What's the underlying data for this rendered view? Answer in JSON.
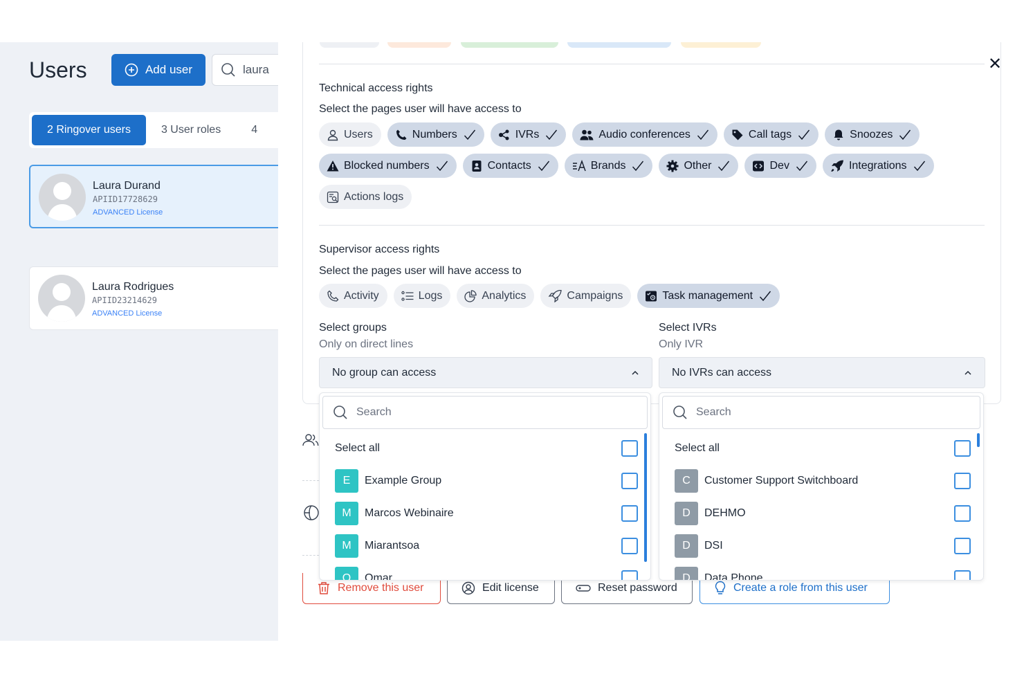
{
  "header": {
    "title": "Users",
    "add_user_label": "Add user",
    "search_value": "laura"
  },
  "tabs": [
    {
      "label": "2 Ringover users",
      "active": true
    },
    {
      "label": "3 User roles",
      "active": false
    },
    {
      "label": "4",
      "active": false
    }
  ],
  "users": [
    {
      "name": "Laura Durand",
      "api_id": "APIID17728629",
      "license": "ADVANCED License",
      "selected": true
    },
    {
      "name": "Laura Rodrigues",
      "api_id": "APIID23214629",
      "license": "ADVANCED License",
      "selected": false
    }
  ],
  "technical": {
    "title": "Technical access rights",
    "subtitle": "Select the pages user will have access to",
    "chips_row1": [
      {
        "label": "Users",
        "icon": "user-icon",
        "on": false
      },
      {
        "label": "Numbers",
        "icon": "phone-icon",
        "on": true
      },
      {
        "label": "IVRs",
        "icon": "ivr-icon",
        "on": true
      },
      {
        "label": "Audio conferences",
        "icon": "people-icon",
        "on": true
      },
      {
        "label": "Call tags",
        "icon": "tag-icon",
        "on": true
      },
      {
        "label": "Snoozes",
        "icon": "bell-icon",
        "on": true
      }
    ],
    "chips_row2": [
      {
        "label": "Blocked numbers",
        "icon": "warning-icon",
        "on": true
      },
      {
        "label": "Contacts",
        "icon": "contact-icon",
        "on": true
      },
      {
        "label": "Brands",
        "icon": "brand-icon",
        "on": true
      },
      {
        "label": "Other",
        "icon": "gear-icon",
        "on": true
      },
      {
        "label": "Dev",
        "icon": "code-icon",
        "on": true
      },
      {
        "label": "Integrations",
        "icon": "rocket-icon",
        "on": true
      }
    ],
    "chips_row3": [
      {
        "label": "Actions logs",
        "icon": "log-icon",
        "on": false
      }
    ]
  },
  "supervisor": {
    "title": "Supervisor access rights",
    "subtitle": "Select the pages user will have access to",
    "chips": [
      {
        "label": "Activity",
        "icon": "phone-outline-icon",
        "on": false
      },
      {
        "label": "Logs",
        "icon": "list-icon",
        "on": false
      },
      {
        "label": "Analytics",
        "icon": "pie-icon",
        "on": false
      },
      {
        "label": "Campaigns",
        "icon": "rocket-outline-icon",
        "on": false
      },
      {
        "label": "Task management",
        "icon": "task-icon",
        "on": true
      }
    ]
  },
  "groups": {
    "label": "Select groups",
    "sublabel": "Only on direct lines",
    "value": "No group can access",
    "search_placeholder": "Search",
    "select_all": "Select all",
    "items": [
      {
        "letter": "E",
        "name": "Example Group"
      },
      {
        "letter": "M",
        "name": "Marcos Webinaire"
      },
      {
        "letter": "M",
        "name": "Miarantsoa"
      },
      {
        "letter": "O",
        "name": "Omar"
      }
    ]
  },
  "ivrs": {
    "label": "Select IVRs",
    "sublabel": "Only IVR",
    "value": "No IVRs can access",
    "search_placeholder": "Search",
    "select_all": "Select all",
    "items": [
      {
        "letter": "C",
        "name": "Customer Support Switchboard"
      },
      {
        "letter": "D",
        "name": "DEHMO"
      },
      {
        "letter": "D",
        "name": "DSI"
      },
      {
        "letter": "D",
        "name": "Data Phone"
      }
    ]
  },
  "actions": {
    "remove": "Remove this user",
    "edit_license": "Edit license",
    "reset_password": "Reset password",
    "create_role": "Create a role from this user"
  },
  "colors": {
    "primary": "#1d6fc9",
    "danger": "#e04b3c",
    "group_badge": "#2ec4c4",
    "ivr_badge": "#8f9ba6"
  }
}
